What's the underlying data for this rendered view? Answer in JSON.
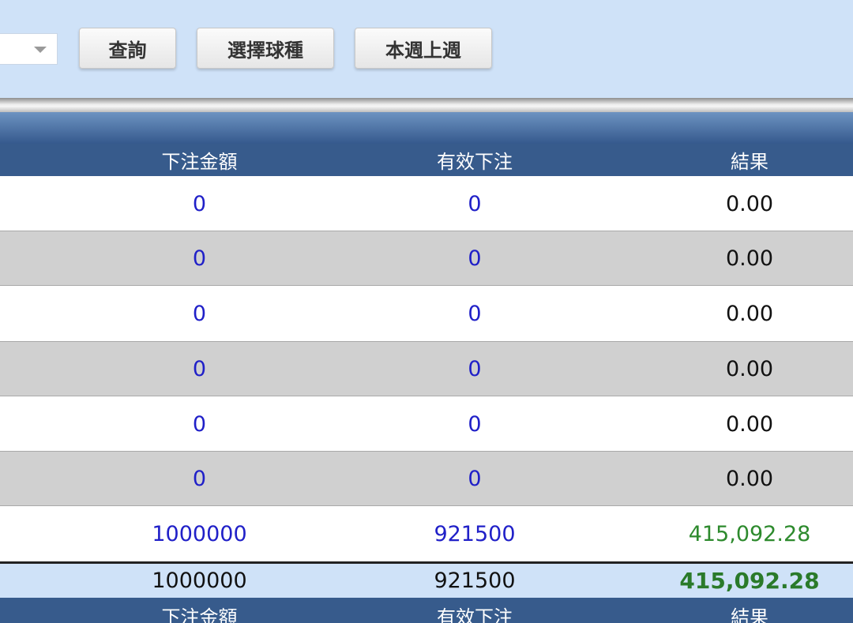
{
  "toolbar": {
    "query_label": "查詢",
    "select_sport_label": "選擇球種",
    "week_label": "本週上週"
  },
  "table": {
    "headers": {
      "bet_amount": "下注金額",
      "valid_bet": "有效下注",
      "result": "結果"
    },
    "rows": [
      {
        "bet_amount": "0",
        "valid_bet": "0",
        "result": "0.00"
      },
      {
        "bet_amount": "0",
        "valid_bet": "0",
        "result": "0.00"
      },
      {
        "bet_amount": "0",
        "valid_bet": "0",
        "result": "0.00"
      },
      {
        "bet_amount": "0",
        "valid_bet": "0",
        "result": "0.00"
      },
      {
        "bet_amount": "0",
        "valid_bet": "0",
        "result": "0.00"
      },
      {
        "bet_amount": "0",
        "valid_bet": "0",
        "result": "0.00"
      },
      {
        "bet_amount": "1000000",
        "valid_bet": "921500",
        "result": "415,092.28"
      }
    ],
    "total": {
      "bet_amount": "1000000",
      "valid_bet": "921500",
      "result": "415,092.28"
    }
  },
  "colors": {
    "toolbar_bg": "#cfe2f8",
    "header_bg": "#375b8c",
    "link_blue": "#2020c8",
    "positive_green": "#2d8a2d"
  },
  "icons": {
    "dropdown": "chevron-down-icon"
  }
}
